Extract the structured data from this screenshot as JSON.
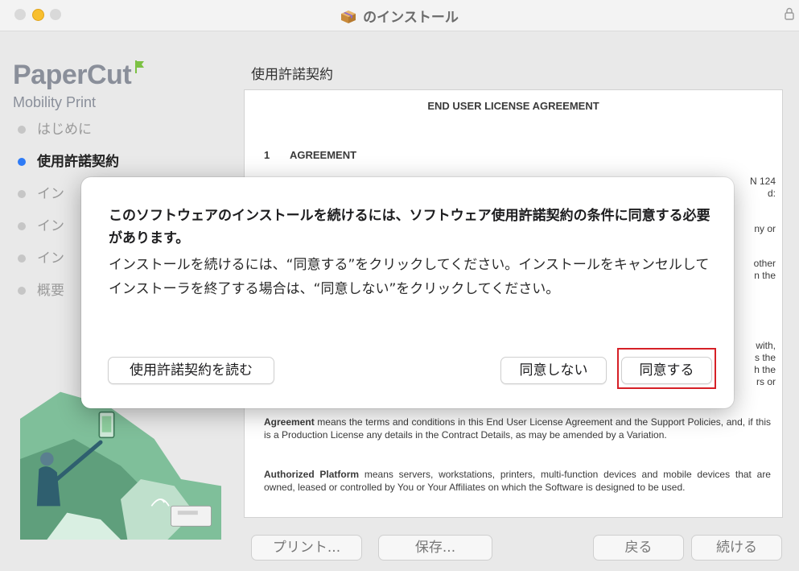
{
  "window": {
    "title": "のインストール",
    "accent_color": "#2e7bf6",
    "highlight_color": "#d62027"
  },
  "sidebar": {
    "brand": "PaperCut",
    "product": "Mobility Print",
    "steps": [
      {
        "label": "はじめに",
        "state": "done"
      },
      {
        "label": "使用許諾契約",
        "state": "active"
      },
      {
        "label": "イン",
        "state": "pending"
      },
      {
        "label": "イン",
        "state": "pending"
      },
      {
        "label": "イン",
        "state": "pending"
      },
      {
        "label": "概要",
        "state": "pending"
      }
    ]
  },
  "main": {
    "section_title": "使用許諾契約",
    "license": {
      "heading": "END USER LICENSE AGREEMENT",
      "clause_number": "1",
      "clause_title": "AGREEMENT",
      "partial_lines_1": [
        "N 124",
        "d:"
      ],
      "partial_line_2": "ny or",
      "partial_lines_3": [
        "other",
        "n the"
      ],
      "partial_lines_4": [
        "with,",
        "s the",
        "h the",
        "rs or"
      ],
      "definitions": [
        {
          "term": "Agreement",
          "text": " means the terms and conditions in this End User License Agreement and the Support Policies, and, if this is a Production License any details in the Contract Details, as may be amended by a Variation."
        },
        {
          "term": "Authorized Platform",
          "text": " means servers, workstations, printers, multi-function devices and mobile devices that are owned, leased or controlled by You or Your Affiliates on which the Software is designed to be used."
        }
      ]
    }
  },
  "footer": {
    "print_label": "プリント...",
    "save_label": "保存...",
    "back_label": "戻る",
    "continue_label": "続ける"
  },
  "dialog": {
    "heading": "このソフトウェアのインストールを続けるには、ソフトウェア使用許諾契約の条件に同意する必要があります。",
    "body": "インストールを続けるには、“同意する”をクリックしてください。インストールをキャンセルしてインストーラを終了する場合は、“同意しない”をクリックしてください。",
    "read_license_label": "使用許諾契約を読む",
    "disagree_label": "同意しない",
    "agree_label": "同意する"
  }
}
